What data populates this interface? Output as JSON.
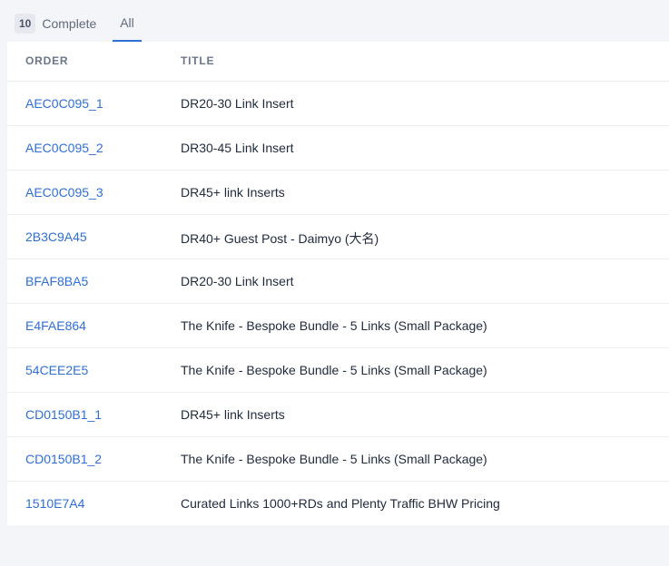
{
  "tabs": {
    "complete": {
      "count": "10",
      "label": "Complete"
    },
    "all": {
      "label": "All",
      "active": true
    }
  },
  "accent_color": "#2f6fd3",
  "table": {
    "columns": [
      "ORDER",
      "TITLE"
    ],
    "rows": [
      {
        "order": "AEC0C095_1",
        "title": "DR20-30 Link Insert"
      },
      {
        "order": "AEC0C095_2",
        "title": "DR30-45 Link Insert"
      },
      {
        "order": "AEC0C095_3",
        "title": "DR45+ link Inserts"
      },
      {
        "order": "2B3C9A45",
        "title": "DR40+ Guest Post - Daimyo (大名)"
      },
      {
        "order": "BFAF8BA5",
        "title": "DR20-30 Link Insert"
      },
      {
        "order": "E4FAE864",
        "title": "The Knife - Bespoke Bundle - 5 Links (Small Package)"
      },
      {
        "order": "54CEE2E5",
        "title": "The Knife - Bespoke Bundle - 5 Links (Small Package)"
      },
      {
        "order": "CD0150B1_1",
        "title": "DR45+ link Inserts"
      },
      {
        "order": "CD0150B1_2",
        "title": "The Knife - Bespoke Bundle - 5 Links (Small Package)"
      },
      {
        "order": "1510E7A4",
        "title": "Curated Links 1000+RDs and Plenty Traffic BHW Pricing"
      }
    ]
  }
}
